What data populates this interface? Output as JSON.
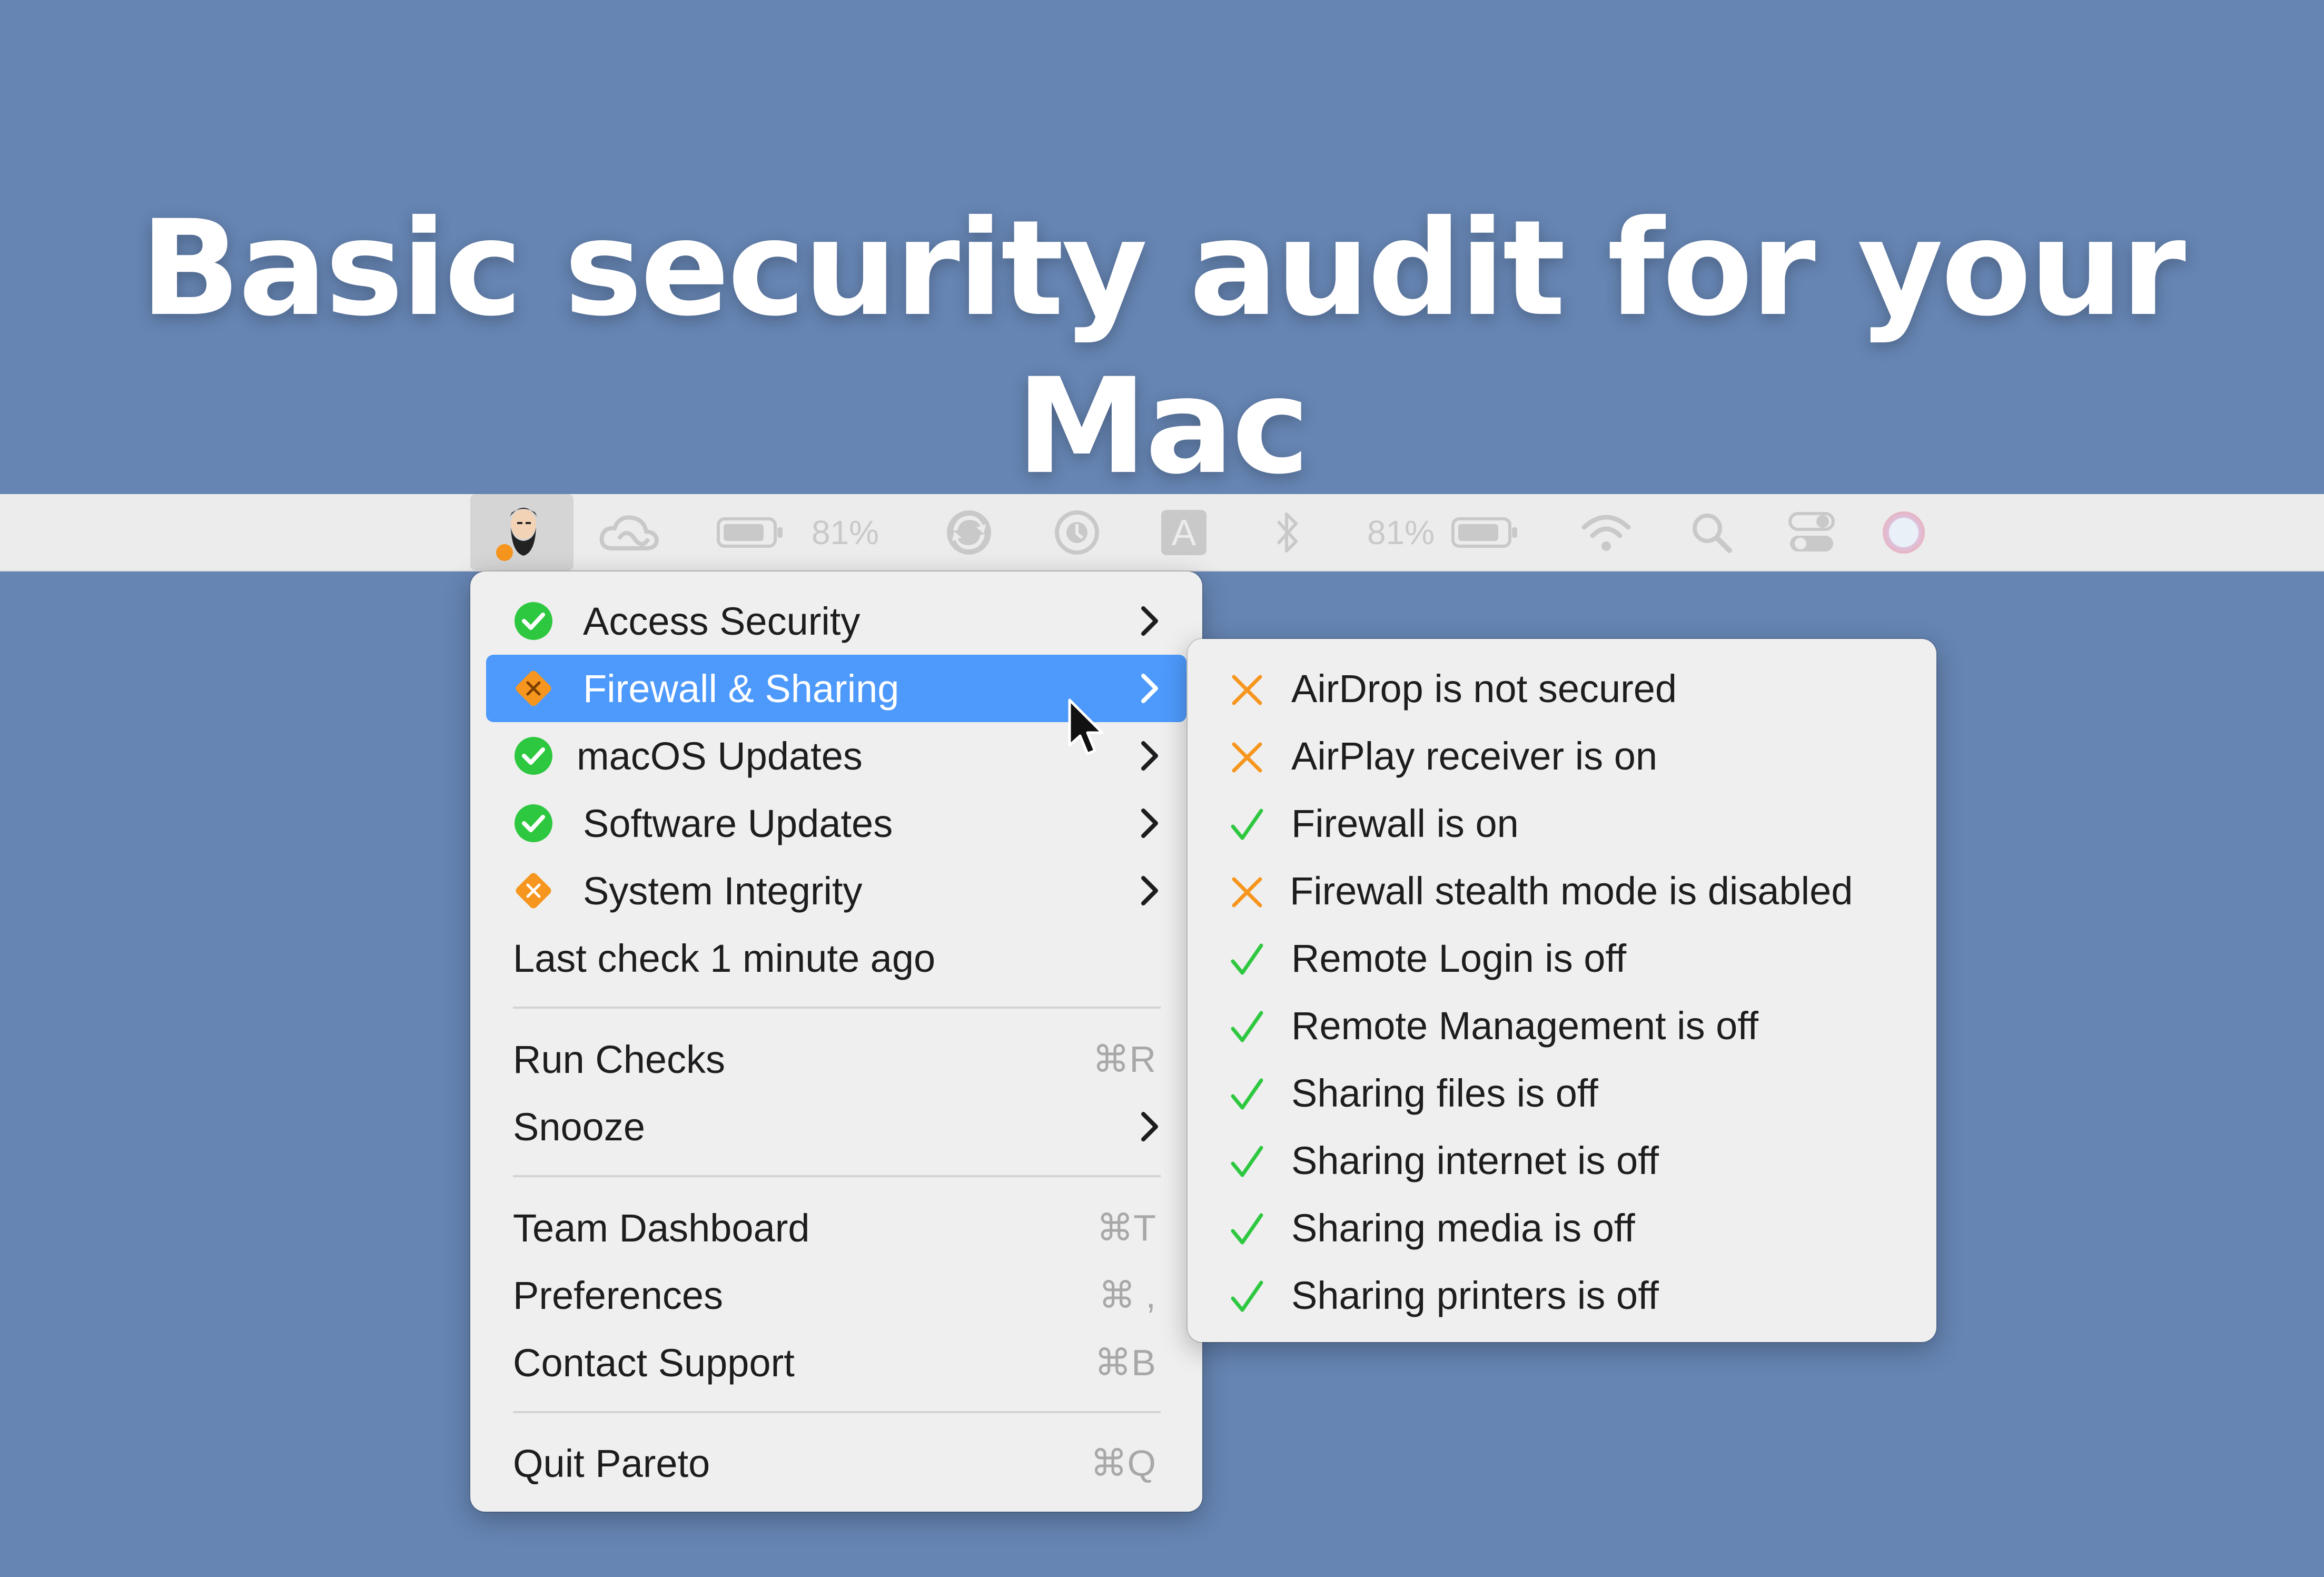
{
  "headline": "Basic security audit for your Mac",
  "menubar": {
    "battery_percent_left": "81%",
    "battery_percent_right": "81%",
    "input_source_letter": "A",
    "items": [
      "pareto-app",
      "creative-cloud",
      "battery",
      "sync",
      "time-machine",
      "input-source",
      "bluetooth",
      "battery-2",
      "wifi",
      "spotlight",
      "control-center",
      "siri"
    ]
  },
  "main_menu": {
    "checks": [
      {
        "label": "Access Security",
        "status": "ok"
      },
      {
        "label": "Firewall & Sharing",
        "status": "warning",
        "highlighted": true
      },
      {
        "label": "macOS Updates",
        "status": "ok"
      },
      {
        "label": "Software Updates",
        "status": "ok"
      },
      {
        "label": "System Integrity",
        "status": "warning"
      }
    ],
    "last_check": "Last check 1 minute ago",
    "run_checks": {
      "label": "Run Checks",
      "shortcut": "⌘R"
    },
    "snooze": {
      "label": "Snooze"
    },
    "team_dashboard": {
      "label": "Team Dashboard",
      "shortcut": "⌘T"
    },
    "preferences": {
      "label": "Preferences",
      "shortcut": "⌘ ,"
    },
    "contact_support": {
      "label": "Contact Support",
      "shortcut": "⌘B"
    },
    "quit": {
      "label": "Quit Pareto",
      "shortcut": "⌘Q"
    }
  },
  "submenu": {
    "items": [
      {
        "label": "AirDrop is not secured",
        "status": "fail"
      },
      {
        "label": "AirPlay receiver is on",
        "status": "fail"
      },
      {
        "label": "Firewall is on",
        "status": "pass"
      },
      {
        "label": "Firewall stealth mode is disabled",
        "status": "fail"
      },
      {
        "label": "Remote Login is off",
        "status": "pass"
      },
      {
        "label": "Remote Management is off",
        "status": "pass"
      },
      {
        "label": "Sharing files is off",
        "status": "pass"
      },
      {
        "label": "Sharing internet is off",
        "status": "pass"
      },
      {
        "label": "Sharing media is off",
        "status": "pass"
      },
      {
        "label": "Sharing printers is off",
        "status": "pass"
      }
    ]
  },
  "colors": {
    "background": "#6685b3",
    "ok_green": "#2ec840",
    "warning_orange": "#f7961e",
    "highlight_blue": "#4d9afc"
  }
}
